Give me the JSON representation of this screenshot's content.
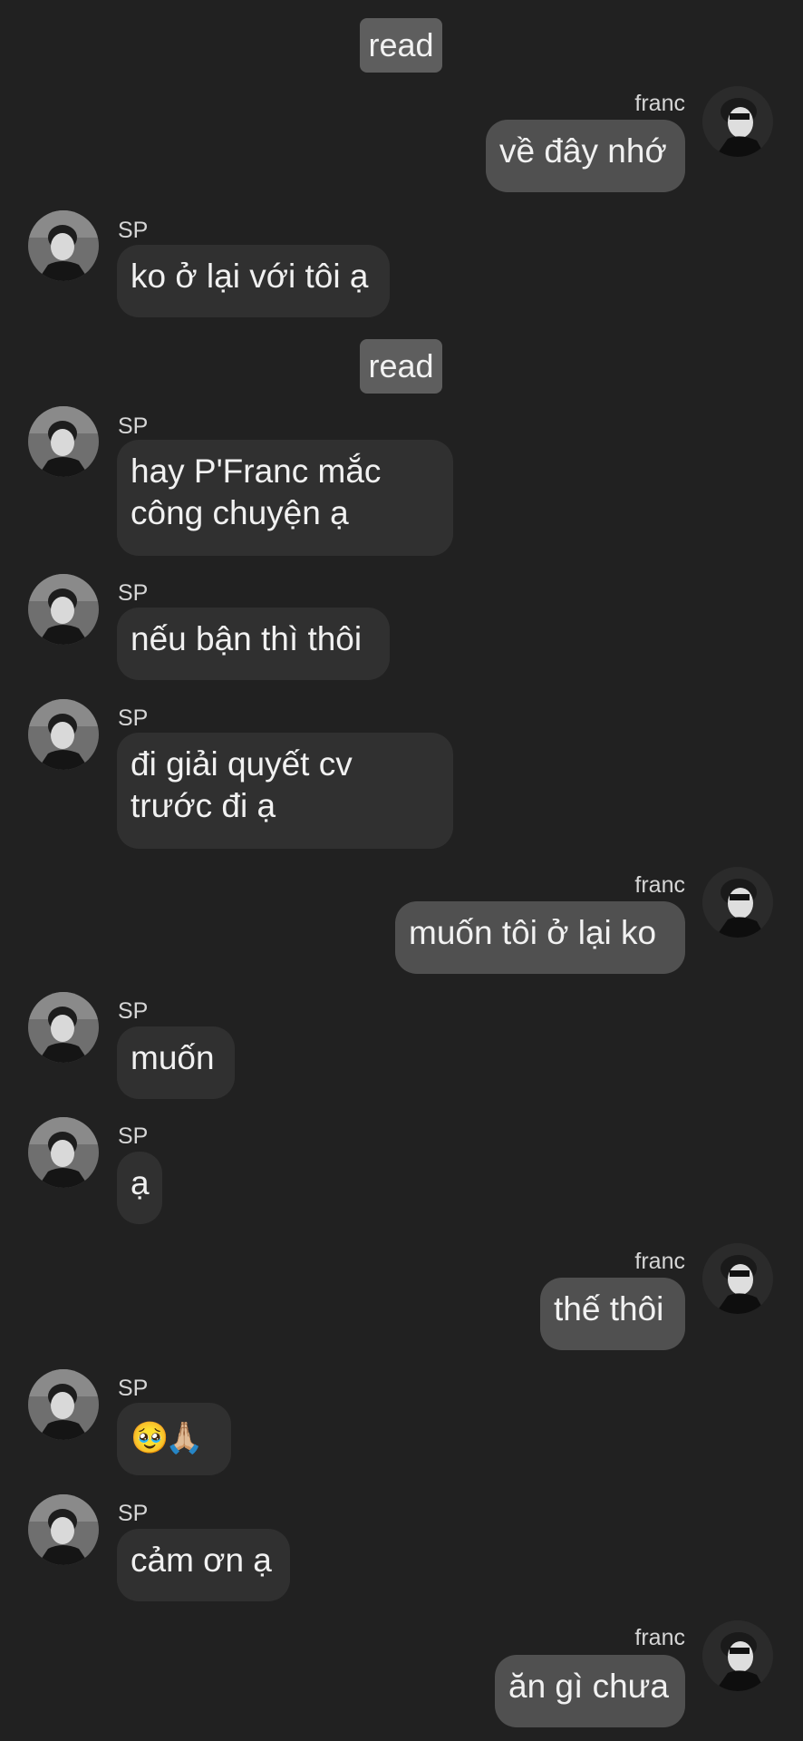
{
  "read_label": "read",
  "contacts": {
    "other": "SP",
    "self": "franc"
  },
  "messages": [
    {
      "from": "franc",
      "text": "về đây nhớ"
    },
    {
      "from": "SP",
      "text": "ko ở lại với tôi ạ"
    },
    {
      "from": "SP",
      "text": "hay P'Franc mắc\ncông chuyện ạ"
    },
    {
      "from": "SP",
      "text": "nếu bận thì thôi"
    },
    {
      "from": "SP",
      "text": "đi giải quyết cv\ntrước đi ạ"
    },
    {
      "from": "franc",
      "text": "muốn tôi ở lại ko"
    },
    {
      "from": "SP",
      "text": "muốn"
    },
    {
      "from": "SP",
      "text": "ạ"
    },
    {
      "from": "franc",
      "text": "thế thôi"
    },
    {
      "from": "SP",
      "text": "🥹🙏🏼"
    },
    {
      "from": "SP",
      "text": "cảm ơn ạ"
    },
    {
      "from": "franc",
      "text": "ăn gì chưa"
    }
  ]
}
